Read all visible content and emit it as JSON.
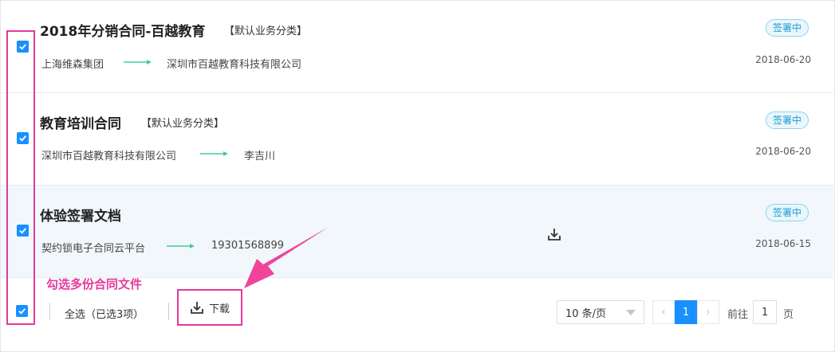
{
  "contracts": [
    {
      "title": "2018年分销合同-百越教育",
      "category": "【默认业务分类】",
      "from": "上海维森集团",
      "to": "深圳市百越教育科技有限公司",
      "status": "签署中",
      "date": "2018-06-20",
      "checked": true
    },
    {
      "title": "教育培训合同",
      "category": "【默认业务分类】",
      "from": "深圳市百越教育科技有限公司",
      "to": "李吉川",
      "status": "签署中",
      "date": "2018-06-20",
      "checked": true
    },
    {
      "title": "体验签署文档",
      "category": "",
      "from": "契约锁电子合同云平台",
      "to": "19301568899",
      "status": "签署中",
      "date": "2018-06-15",
      "checked": true
    }
  ],
  "annotation": "勾选多份合同文件",
  "footer": {
    "select_all": "全选（已选3项）",
    "download": "下载",
    "page_size": "10 条/页",
    "current_page": "1",
    "goto_label": "前往",
    "goto_value": "1",
    "page_unit": "页"
  },
  "colors": {
    "accent": "#1890ff",
    "annotation": "#e6389c",
    "status_text": "#1e9ad2",
    "arrow": "#3ecf9a"
  },
  "icons": {
    "checkbox": "check-icon",
    "download": "download-icon",
    "prev": "chevron-left-icon",
    "next": "chevron-right-icon"
  }
}
